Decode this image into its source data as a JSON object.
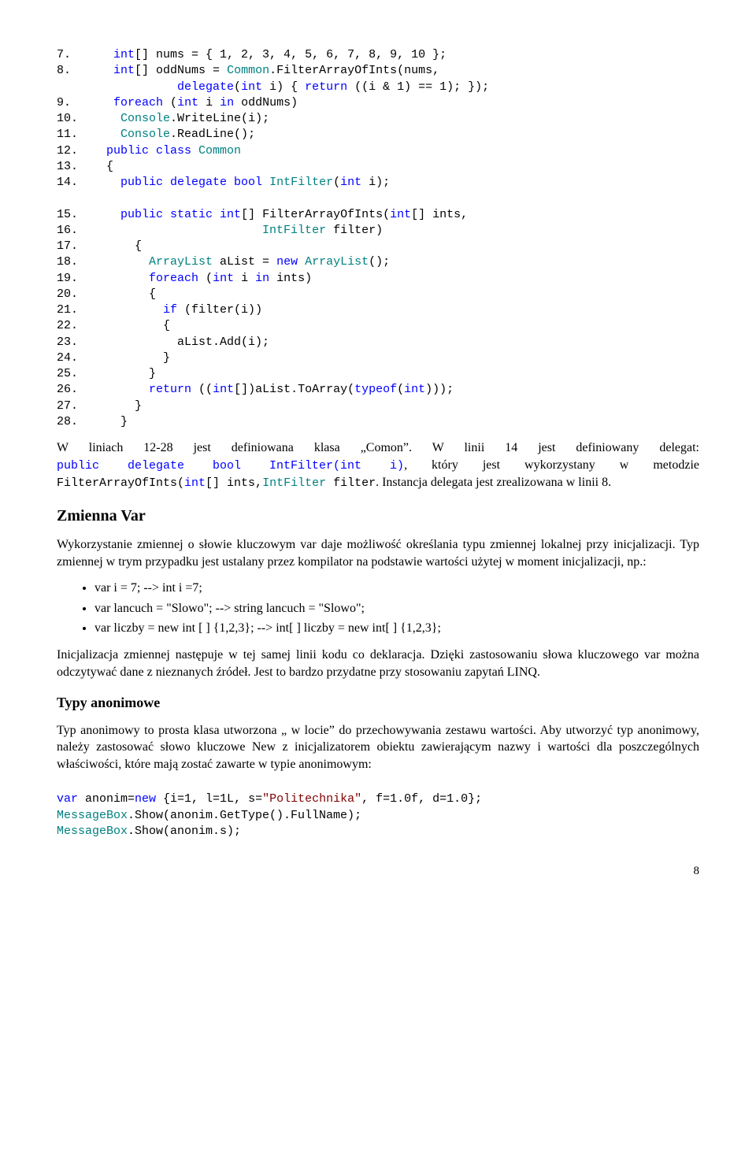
{
  "code1": [
    {
      "n": "7.",
      "segs": [
        {
          "c": "blue",
          "t": "    int"
        },
        {
          "c": "black",
          "t": "[] nums = { 1, 2, 3, 4, 5, 6, 7, 8, 9, 10 };"
        }
      ]
    },
    {
      "n": "8.",
      "segs": [
        {
          "c": "blue",
          "t": "    int"
        },
        {
          "c": "black",
          "t": "[] oddNums = "
        },
        {
          "c": "teal",
          "t": "Common"
        },
        {
          "c": "black",
          "t": ".FilterArrayOfInts(nums,"
        }
      ]
    },
    {
      "n": "",
      "segs": [
        {
          "c": "blue",
          "t": "             delegate"
        },
        {
          "c": "black",
          "t": "("
        },
        {
          "c": "blue",
          "t": "int"
        },
        {
          "c": "black",
          "t": " i) { "
        },
        {
          "c": "blue",
          "t": "return"
        },
        {
          "c": "black",
          "t": " ((i & 1) == 1); });"
        }
      ]
    },
    {
      "n": "9.",
      "segs": [
        {
          "c": "blue",
          "t": "    foreach"
        },
        {
          "c": "black",
          "t": " ("
        },
        {
          "c": "blue",
          "t": "int"
        },
        {
          "c": "black",
          "t": " i "
        },
        {
          "c": "blue",
          "t": "in"
        },
        {
          "c": "black",
          "t": " oddNums)"
        }
      ]
    },
    {
      "n": "10.",
      "segs": [
        {
          "c": "teal",
          "t": "     Console"
        },
        {
          "c": "black",
          "t": ".WriteLine(i);"
        }
      ]
    },
    {
      "n": "11.",
      "segs": [
        {
          "c": "teal",
          "t": "     Console"
        },
        {
          "c": "black",
          "t": ".ReadLine();"
        }
      ]
    },
    {
      "n": "12.",
      "segs": [
        {
          "c": "blue",
          "t": "   public class "
        },
        {
          "c": "teal",
          "t": "Common"
        }
      ]
    },
    {
      "n": "13.",
      "segs": [
        {
          "c": "black",
          "t": "   {"
        }
      ]
    },
    {
      "n": "14.",
      "segs": [
        {
          "c": "blue",
          "t": "     public delegate bool "
        },
        {
          "c": "teal",
          "t": "IntFilter"
        },
        {
          "c": "black",
          "t": "("
        },
        {
          "c": "blue",
          "t": "int"
        },
        {
          "c": "black",
          "t": " i);"
        }
      ]
    },
    {
      "n": "",
      "segs": [
        {
          "c": "black",
          "t": ""
        }
      ]
    },
    {
      "n": "15.",
      "segs": [
        {
          "c": "blue",
          "t": "     public static int"
        },
        {
          "c": "black",
          "t": "[] FilterArrayOfInts("
        },
        {
          "c": "blue",
          "t": "int"
        },
        {
          "c": "black",
          "t": "[] ints,"
        }
      ]
    },
    {
      "n": "16.",
      "segs": [
        {
          "c": "teal",
          "t": "                         IntFilter"
        },
        {
          "c": "black",
          "t": " filter)"
        }
      ]
    },
    {
      "n": "17.",
      "segs": [
        {
          "c": "black",
          "t": "       {"
        }
      ]
    },
    {
      "n": "18.",
      "segs": [
        {
          "c": "teal",
          "t": "         ArrayList"
        },
        {
          "c": "black",
          "t": " aList = "
        },
        {
          "c": "blue",
          "t": "new"
        },
        {
          "c": "black",
          "t": " "
        },
        {
          "c": "teal",
          "t": "ArrayList"
        },
        {
          "c": "black",
          "t": "();"
        }
      ]
    },
    {
      "n": "19.",
      "segs": [
        {
          "c": "blue",
          "t": "         foreach"
        },
        {
          "c": "black",
          "t": " ("
        },
        {
          "c": "blue",
          "t": "int"
        },
        {
          "c": "black",
          "t": " i "
        },
        {
          "c": "blue",
          "t": "in"
        },
        {
          "c": "black",
          "t": " ints)"
        }
      ]
    },
    {
      "n": "20.",
      "segs": [
        {
          "c": "black",
          "t": "         {"
        }
      ]
    },
    {
      "n": "21.",
      "segs": [
        {
          "c": "blue",
          "t": "           if"
        },
        {
          "c": "black",
          "t": " (filter(i))"
        }
      ]
    },
    {
      "n": "22.",
      "segs": [
        {
          "c": "black",
          "t": "           {"
        }
      ]
    },
    {
      "n": "23.",
      "segs": [
        {
          "c": "black",
          "t": "             aList.Add(i);"
        }
      ]
    },
    {
      "n": "24.",
      "segs": [
        {
          "c": "black",
          "t": "           }"
        }
      ]
    },
    {
      "n": "25.",
      "segs": [
        {
          "c": "black",
          "t": "         }"
        }
      ]
    },
    {
      "n": "26.",
      "segs": [
        {
          "c": "blue",
          "t": "         return"
        },
        {
          "c": "black",
          "t": " (("
        },
        {
          "c": "blue",
          "t": "int"
        },
        {
          "c": "black",
          "t": "[])aList.ToArray("
        },
        {
          "c": "blue",
          "t": "typeof"
        },
        {
          "c": "black",
          "t": "("
        },
        {
          "c": "blue",
          "t": "int"
        },
        {
          "c": "black",
          "t": ")));"
        }
      ]
    },
    {
      "n": "27.",
      "segs": [
        {
          "c": "black",
          "t": "       }"
        }
      ]
    },
    {
      "n": "28.",
      "segs": [
        {
          "c": "black",
          "t": "     }"
        }
      ]
    }
  ],
  "para1": {
    "pre": "W liniach 12-28 jest definiowana klasa „Comon”. W linii 14 jest definiowany delegat: ",
    "code1a": "public delegate bool IntFilter(int i)",
    "mid1": ", który jest wykorzystany w metodzie ",
    "code1b1": "FilterArrayOfInts(",
    "code1b2": "int",
    "code1b3": "[] ints,",
    "code1b4": "IntFilter",
    "code1b5": " filter",
    "post": ". Instancja delegata jest zrealizowana w linii 8."
  },
  "h_var": "Zmienna Var",
  "para2": "Wykorzystanie zmiennej o słowie kluczowym var daje możliwość określania typu zmiennej lokalnej przy inicjalizacji. Typ zmiennej w trym przypadku jest ustalany przez kompilator na podstawie wartości użytej w moment inicjalizacji, np.:",
  "bullets": [
    "var i = 7; --> int i =7;",
    "var lancuch = \"Slowo\"; --> string lancuch = \"Slowo\";",
    "var liczby = new int [ ] {1,2,3}; --> int[ ] liczby = new int[ ] {1,2,3};"
  ],
  "para3": "Inicjalizacja zmiennej następuje w tej samej linii kodu co deklaracja. Dzięki zastosowaniu słowa kluczowego var można odczytywać dane z nieznanych źródeł. Jest to bardzo przydatne przy stosowaniu zapytań LINQ.",
  "h_anon": "Typy anonimowe",
  "para4": " Typ anonimowy to prosta klasa utworzona „ w locie” do przechowywania zestawu wartości. Aby utworzyć typ anonimowy, należy zastosować słowo kluczowe New z inicjalizatorem obiektu zawierającym nazwy i wartości dla poszczególnych właściwości, które mają zostać zawarte w typie anonimowym:",
  "code2": [
    [
      {
        "c": "blue",
        "t": "var"
      },
      {
        "c": "black",
        "t": " anonim="
      },
      {
        "c": "blue",
        "t": "new"
      },
      {
        "c": "black",
        "t": " {i=1, l=1L, s="
      },
      {
        "c": "maroon",
        "t": "\"Politechnika\""
      },
      {
        "c": "black",
        "t": ", f=1.0f, d=1.0};"
      }
    ],
    [
      {
        "c": "teal",
        "t": "MessageBox"
      },
      {
        "c": "black",
        "t": ".Show(anonim.GetType().FullName);"
      }
    ],
    [
      {
        "c": "teal",
        "t": "MessageBox"
      },
      {
        "c": "black",
        "t": ".Show(anonim.s);"
      }
    ]
  ],
  "pagenum": "8"
}
